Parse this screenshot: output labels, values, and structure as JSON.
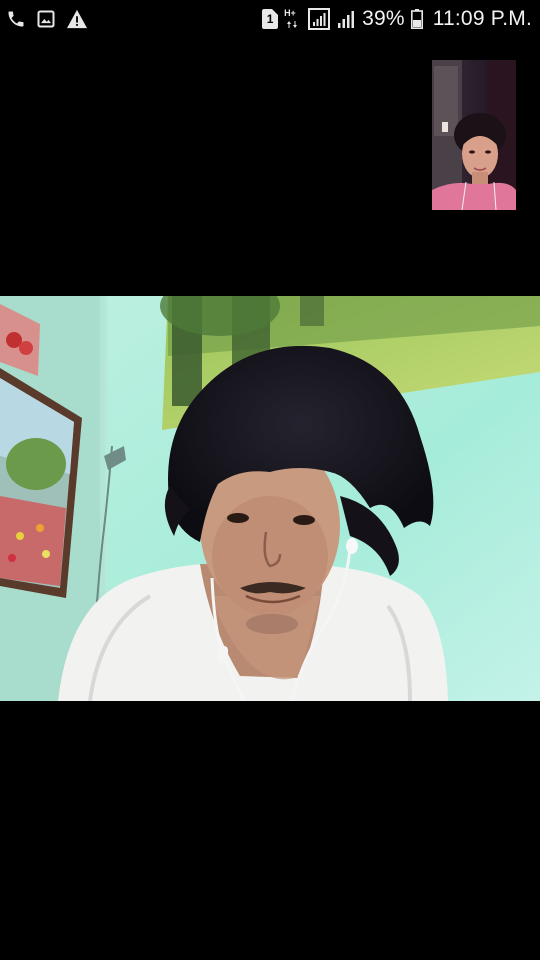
{
  "status_bar": {
    "left_icons": [
      "phone-icon",
      "image-icon",
      "warning-icon"
    ],
    "sim_badge": "1",
    "network_type": "H+",
    "battery_percent": "39%",
    "time": "11:09 P.M."
  },
  "call": {
    "self_preview_icon": "front-camera-preview",
    "remote_video_icon": "remote-video-feed"
  }
}
